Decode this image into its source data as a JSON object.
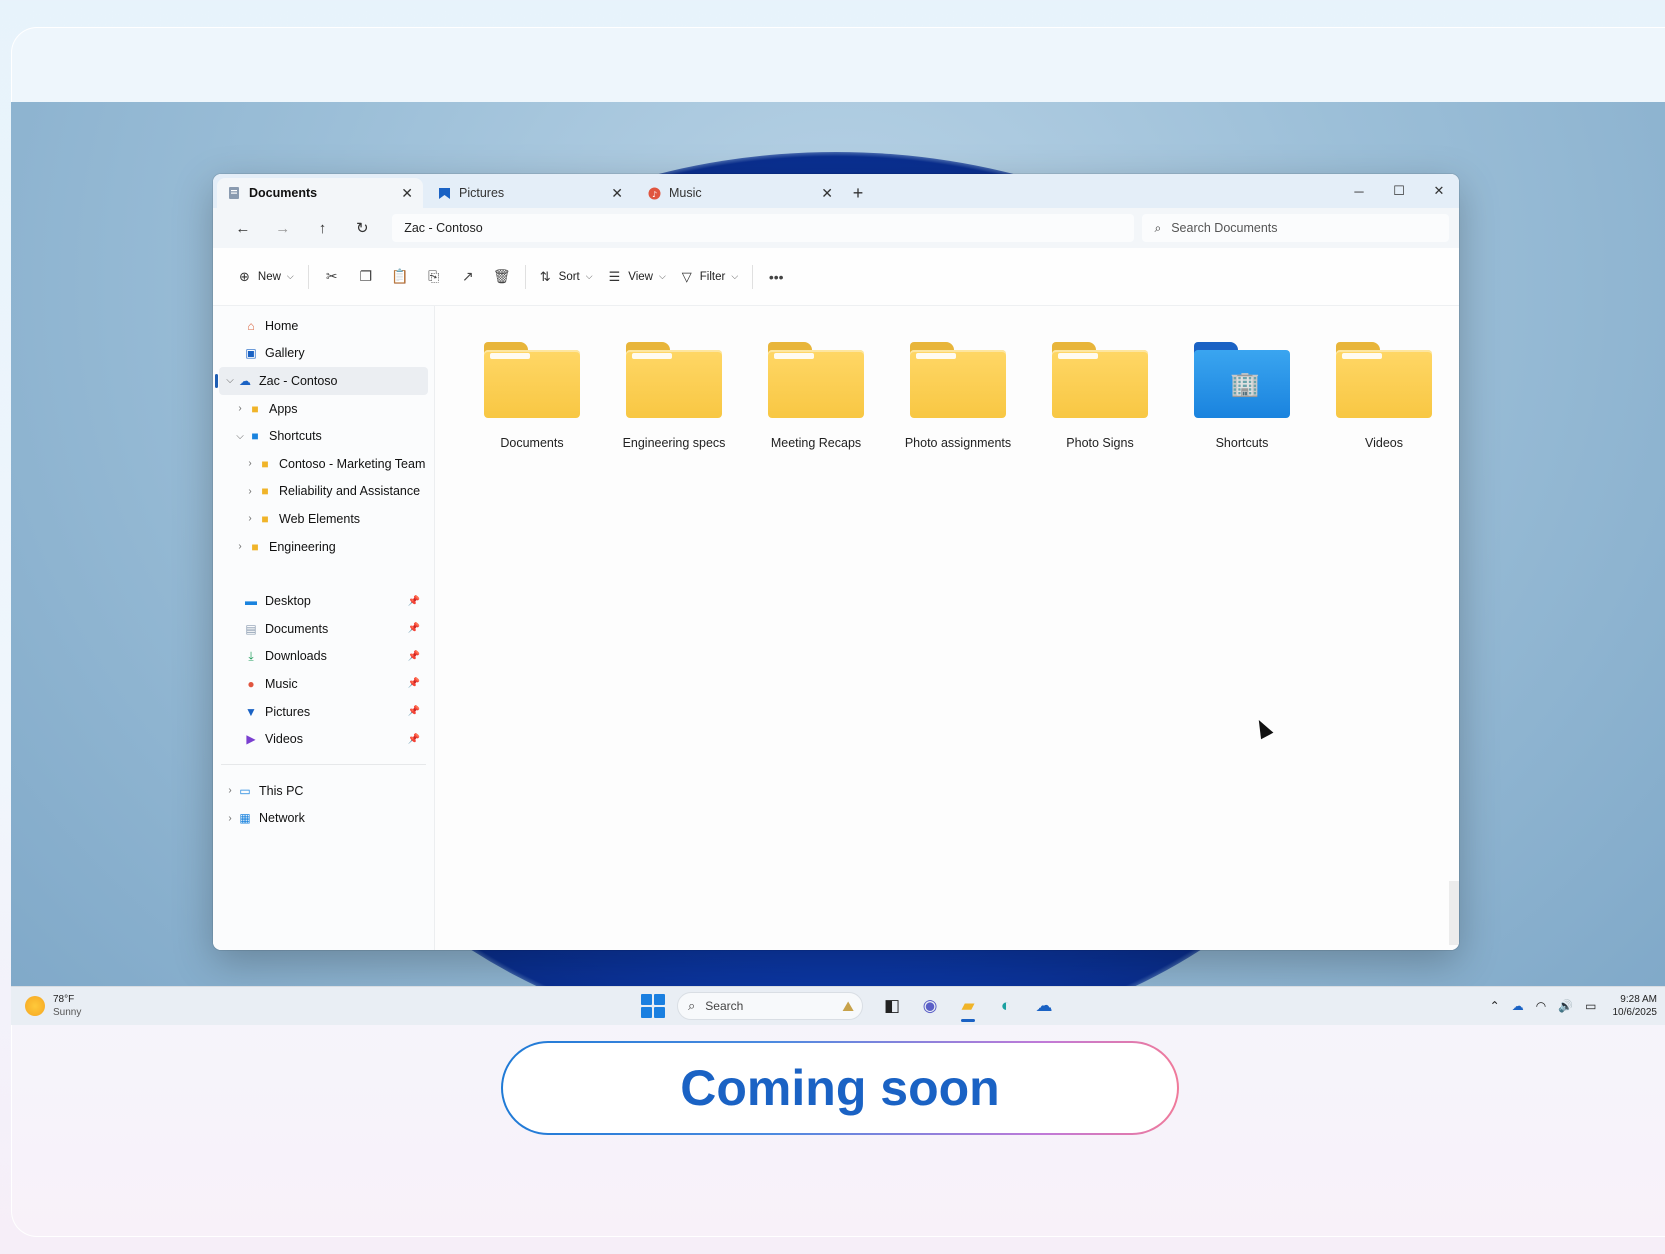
{
  "window": {
    "tabs": [
      {
        "label": "Documents",
        "icon": "document-icon",
        "active": true
      },
      {
        "label": "Pictures",
        "icon": "pictures-icon",
        "active": false
      },
      {
        "label": "Music",
        "icon": "music-icon",
        "active": false
      }
    ],
    "address": "Zac - Contoso",
    "search_placeholder": "Search Documents",
    "toolbar": {
      "new_label": "New",
      "sort_label": "Sort",
      "view_label": "View",
      "filter_label": "Filter"
    }
  },
  "sidebar": {
    "home": "Home",
    "gallery": "Gallery",
    "cloud_root": "Zac - Contoso",
    "apps": "Apps",
    "shortcuts": "Shortcuts",
    "sub_shortcuts": [
      "Contoso - Marketing Team",
      "Reliability and Assistance",
      "Web Elements"
    ],
    "engineering": "Engineering",
    "pinned": [
      "Desktop",
      "Documents",
      "Downloads",
      "Music",
      "Pictures",
      "Videos"
    ],
    "this_pc": "This PC",
    "network": "Network"
  },
  "folders": [
    {
      "name": "Documents",
      "color": "#f8c743"
    },
    {
      "name": "Engineering specs",
      "color": "#f8c743"
    },
    {
      "name": "Meeting Recaps",
      "color": "#f8c743"
    },
    {
      "name": "Photo assignments",
      "color": "#f8c743"
    },
    {
      "name": "Photo Signs",
      "color": "#f8c743"
    },
    {
      "name": "Shortcuts",
      "color": "#1a83de"
    },
    {
      "name": "Videos",
      "color": "#f8c743"
    }
  ],
  "taskbar": {
    "temperature": "78°F",
    "condition": "Sunny",
    "search_placeholder": "Search",
    "time": "9:28 AM",
    "date": "10/6/2025"
  },
  "banner": {
    "label": "Coming soon"
  },
  "colors": {
    "accent": "#1a62c4",
    "folder_yellow": "#f8c743",
    "folder_blue": "#1a83de"
  }
}
